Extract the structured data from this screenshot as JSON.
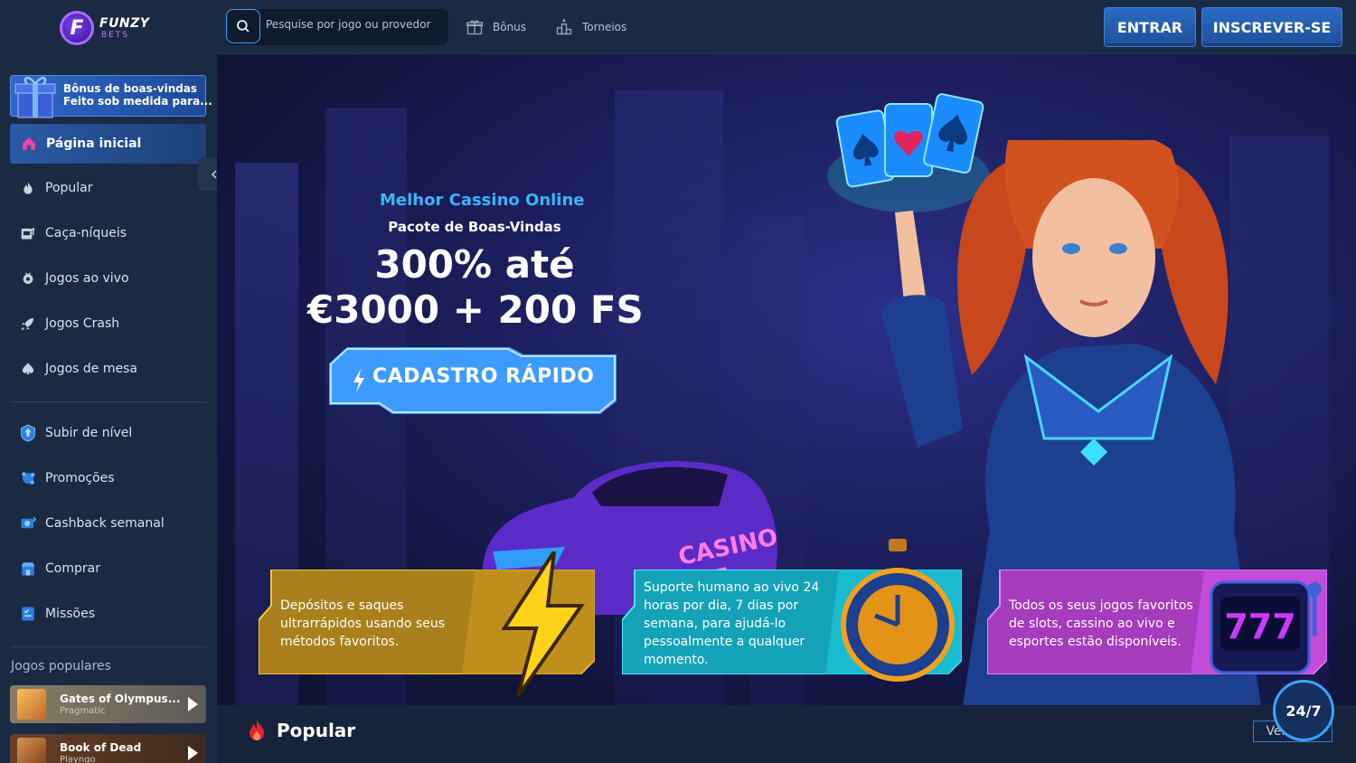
{
  "brand": {
    "name": "FUNZY",
    "sub": "BETS",
    "mark": "F"
  },
  "header": {
    "search_placeholder": "Pesquise por jogo ou provedor",
    "nav": [
      {
        "label": "Bônus",
        "icon": "gift-icon"
      },
      {
        "label": "Torneios",
        "icon": "podium-icon"
      }
    ],
    "login_label": "ENTRAR",
    "register_label": "INSCREVER-SE"
  },
  "sidebar": {
    "bonus_card": {
      "line1": "Bônus de boas-vindas",
      "line2": "Feito sob medida para..."
    },
    "home": {
      "label": "Página inicial",
      "icon": "home-icon"
    },
    "items": [
      {
        "label": "Popular",
        "icon": "flame-icon"
      },
      {
        "label": "Caça-níqueis",
        "icon": "slot-machine-icon"
      },
      {
        "label": "Jogos ao vivo",
        "icon": "live-icon"
      },
      {
        "label": "Jogos Crash",
        "icon": "rocket-icon"
      },
      {
        "label": "Jogos de mesa",
        "icon": "spade-icon"
      }
    ],
    "items2": [
      {
        "label": "Subir de nível",
        "icon": "level-up-icon"
      },
      {
        "label": "Promoções",
        "icon": "promo-icon"
      },
      {
        "label": "Cashback semanal",
        "icon": "cashback-icon"
      },
      {
        "label": "Comprar",
        "icon": "shop-icon"
      },
      {
        "label": "Missões",
        "icon": "missions-icon"
      }
    ],
    "popular_games_title": "Jogos populares",
    "games": [
      {
        "name": "Gates of Olympus...",
        "provider": "Pragmatic"
      },
      {
        "name": "Book of Dead",
        "provider": "Playngo"
      }
    ]
  },
  "hero": {
    "kicker": "Melhor Cassino Online",
    "subtitle": "Pacote de Boas-Vindas",
    "title_line1": "300% até",
    "title_line2": "€3000 + 200 FS",
    "cta_label": "CADASTRO RÁPIDO",
    "car_text": "CASINO",
    "car_number": "777",
    "features": [
      "Depósitos e saques ultrarrápidos usando seus métodos favoritos.",
      "Suporte humano ao vivo 24 horas por dia, 7 dias por semana, para ajudá-lo pessoalmente a qualquer momento.",
      "Todos os seus jogos favoritos de slots, cassino ao vivo e esportes estão disponíveis."
    ],
    "slot_digits": "777"
  },
  "chat": {
    "label": "24/7"
  },
  "popular_section": {
    "title": "Popular",
    "see_all": "Ver tudo"
  }
}
